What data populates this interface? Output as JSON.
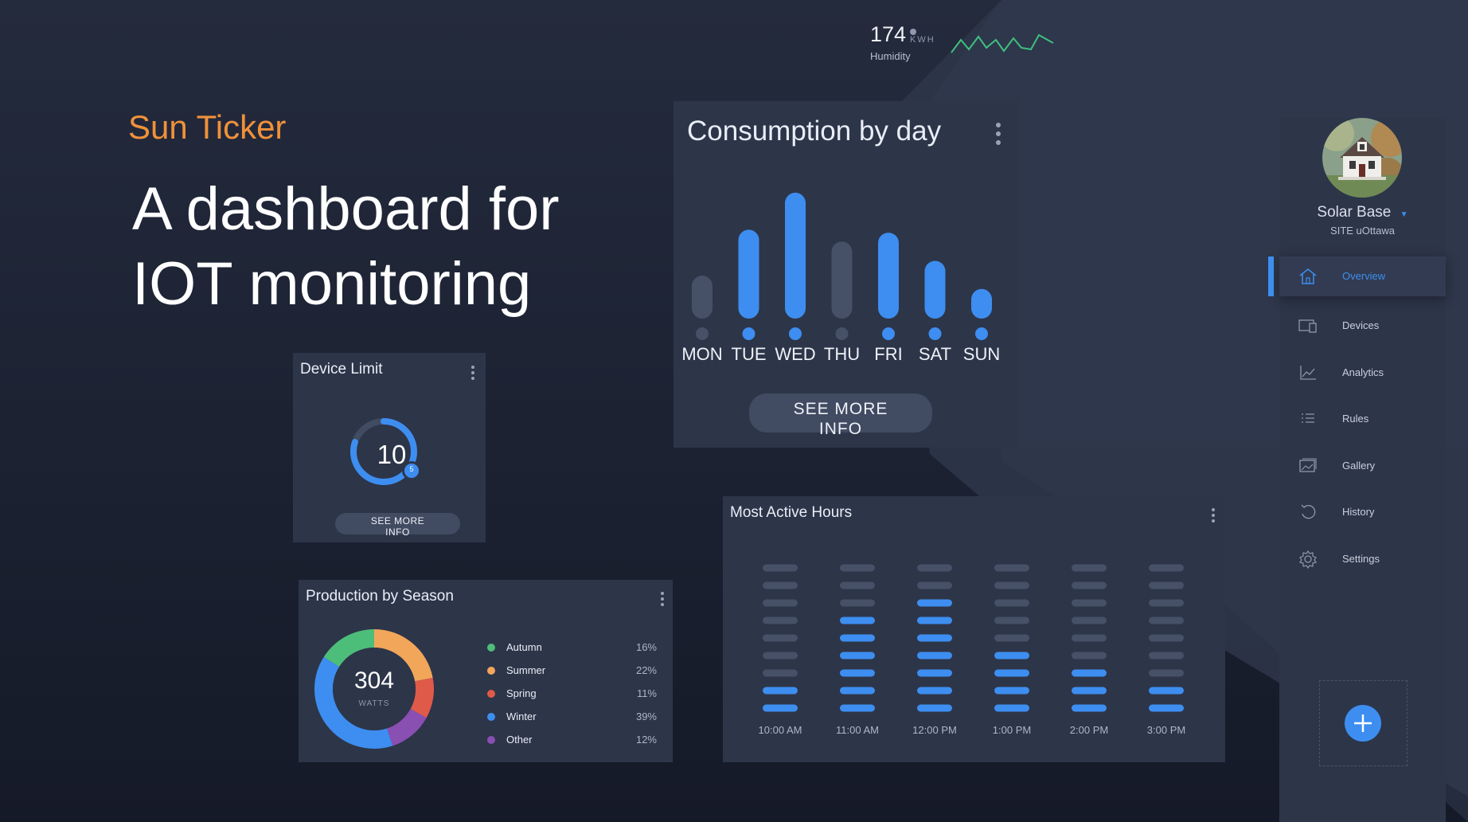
{
  "hero": {
    "brand": "Sun Ticker",
    "headline_line1": "A dashboard for",
    "headline_line2": "IOT monitoring"
  },
  "humidity": {
    "value": "174",
    "unit": "KWH",
    "label": "Humidity"
  },
  "consumption": {
    "title": "Consumption by day",
    "button": "SEE MORE INFO",
    "button_line1": "SEE MORE",
    "button_line2": "INFO"
  },
  "device_limit": {
    "title": "Device Limit",
    "value": "10",
    "badge": "5",
    "progress": 0.8,
    "button_line1": "SEE MORE",
    "button_line2": "INFO"
  },
  "production": {
    "title": "Production by Season",
    "total": "304",
    "unit": "WATTS",
    "legend": [
      {
        "name": "Autumn",
        "pct": "16%",
        "color": "#4dbd7a"
      },
      {
        "name": "Summer",
        "pct": "22%",
        "color": "#f2a65a"
      },
      {
        "name": "Spring",
        "pct": "11%",
        "color": "#e05a4a"
      },
      {
        "name": "Winter",
        "pct": "39%",
        "color": "#3d8ef0"
      },
      {
        "name": "Other",
        "pct": "12%",
        "color": "#8a4fb3"
      }
    ]
  },
  "active_hours": {
    "title": "Most Active Hours"
  },
  "sidebar": {
    "site_name": "Solar Base",
    "site_sub": "SITE uOttawa",
    "items": [
      {
        "label": "Overview",
        "icon": "home-icon",
        "active": true
      },
      {
        "label": "Devices",
        "icon": "devices-icon",
        "active": false
      },
      {
        "label": "Analytics",
        "icon": "analytics-icon",
        "active": false
      },
      {
        "label": "Rules",
        "icon": "rules-icon",
        "active": false
      },
      {
        "label": "Gallery",
        "icon": "gallery-icon",
        "active": false
      },
      {
        "label": "History",
        "icon": "history-icon",
        "active": false
      },
      {
        "label": "Settings",
        "icon": "settings-icon",
        "active": false
      }
    ]
  },
  "colors": {
    "accent": "#3d8ef0",
    "brand": "#f0913a",
    "inactive_bar": "#465067"
  },
  "chart_data": [
    {
      "type": "bar",
      "title": "Consumption by day",
      "categories": [
        "MON",
        "TUE",
        "WED",
        "THU",
        "FRI",
        "SAT",
        "SUN"
      ],
      "values": [
        0.29,
        0.6,
        0.85,
        0.52,
        0.58,
        0.39,
        0.2
      ],
      "highlighted": [
        false,
        true,
        true,
        false,
        true,
        true,
        true
      ],
      "ylim": [
        0,
        1
      ]
    },
    {
      "type": "pie",
      "title": "Production by Season",
      "categories": [
        "Autumn",
        "Summer",
        "Spring",
        "Winter",
        "Other"
      ],
      "values": [
        16,
        22,
        11,
        39,
        12
      ]
    },
    {
      "type": "heatmap",
      "title": "Most Active Hours",
      "categories": [
        "10:00 AM",
        "11:00 AM",
        "12:00 PM",
        "1:00 PM",
        "2:00 PM",
        "3:00 PM"
      ],
      "values": [
        2,
        6,
        7,
        4,
        3,
        2
      ],
      "max": 9
    }
  ]
}
